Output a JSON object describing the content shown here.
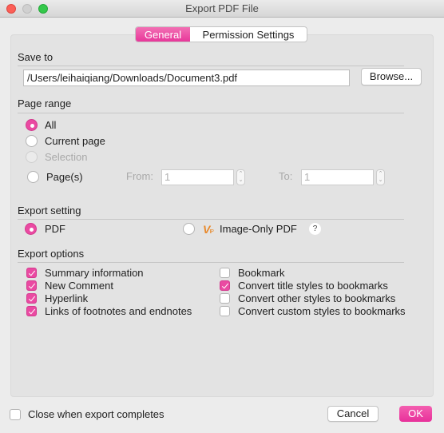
{
  "window": {
    "title": "Export PDF File"
  },
  "tabs": [
    {
      "label": "General",
      "active": true
    },
    {
      "label": "Permission Settings",
      "active": false
    }
  ],
  "save_to": {
    "title": "Save to",
    "path_value": "/Users/leihaiqiang/Downloads/Document3.pdf",
    "browse_label": "Browse..."
  },
  "page_range": {
    "title": "Page range",
    "options": [
      {
        "label": "All",
        "checked": true,
        "disabled": false
      },
      {
        "label": "Current page",
        "checked": false,
        "disabled": false
      },
      {
        "label": "Selection",
        "checked": false,
        "disabled": true
      },
      {
        "label": "Page(s)",
        "checked": false,
        "disabled": false
      }
    ],
    "from_label": "From:",
    "from_value": "1",
    "to_label": "To:",
    "to_value": "1"
  },
  "export_setting": {
    "title": "Export setting",
    "options": [
      {
        "label": "PDF",
        "checked": true
      },
      {
        "label": "Image-Only PDF",
        "checked": false,
        "badge": "VIP"
      }
    ],
    "help_label": "?"
  },
  "export_options": {
    "title": "Export options",
    "left": [
      {
        "label": "Summary information",
        "checked": true
      },
      {
        "label": "New Comment",
        "checked": true
      },
      {
        "label": "Hyperlink",
        "checked": true
      },
      {
        "label": "Links of footnotes and endnotes",
        "checked": true
      }
    ],
    "right": [
      {
        "label": "Bookmark",
        "checked": false
      },
      {
        "label": "Convert title styles to bookmarks",
        "checked": true
      },
      {
        "label": "Convert other styles to bookmarks",
        "checked": false
      },
      {
        "label": "Convert custom styles to bookmarks",
        "checked": false
      }
    ]
  },
  "footer": {
    "close_when_done_label": "Close when export completes",
    "close_when_done_checked": false,
    "cancel_label": "Cancel",
    "ok_label": "OK"
  },
  "colors": {
    "accent": "#ea4aa2",
    "vip": "#e8892b"
  }
}
